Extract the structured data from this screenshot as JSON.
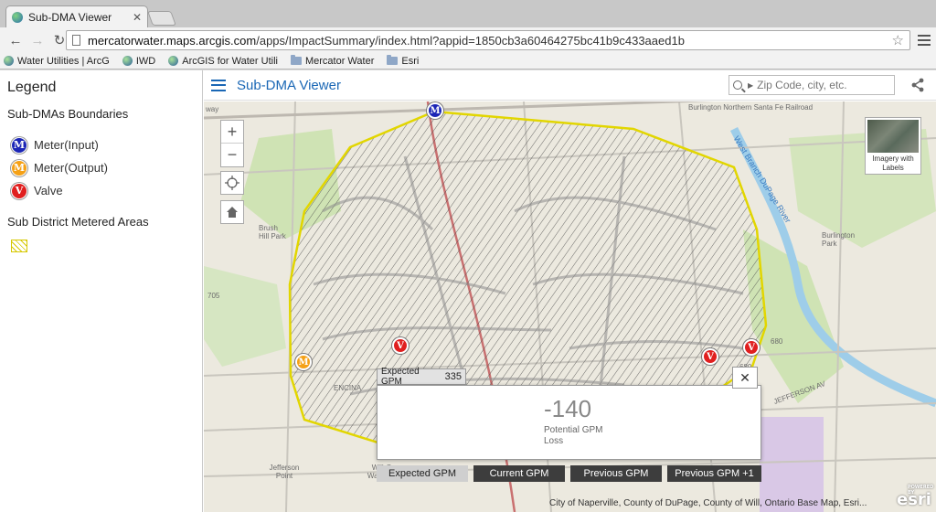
{
  "browser": {
    "tab_title": "Sub-DMA Viewer",
    "url_host": "mercatorwater.maps.arcgis.com",
    "url_path": "/apps/ImpactSummary/index.html?appid=1850cb3a60464275bc41b9c433aaed1b",
    "bookmarks": [
      {
        "label": "Water Utilities | ArcG",
        "icon": "globe-icon"
      },
      {
        "label": "IWD",
        "icon": "globe-icon"
      },
      {
        "label": "ArcGIS for Water Utili",
        "icon": "globe-icon"
      },
      {
        "label": "Mercator Water",
        "icon": "folder-icon"
      },
      {
        "label": "Esri",
        "icon": "folder-icon"
      }
    ]
  },
  "legend": {
    "title": "Legend",
    "section1": "Sub-DMAs Boundaries",
    "items": [
      {
        "label": "Meter(Input)",
        "glyph": "M",
        "color": "#1c26b6"
      },
      {
        "label": "Meter(Output)",
        "glyph": "M",
        "color": "#f5a117"
      },
      {
        "label": "Valve",
        "glyph": "V",
        "color": "#e01f1f"
      }
    ],
    "section2": "Sub District Metered Areas"
  },
  "header": {
    "title": "Sub-DMA Viewer",
    "search_placeholder": "Zip Code, city, etc."
  },
  "map": {
    "basemap_label": "Imagery with Labels",
    "labels": {
      "brush_hill": "Brush Hill Park",
      "burlington_park": "Burlington Park",
      "river": "West Branch DuPage River",
      "railway": "Burlington Northern Santa Fe Railroad",
      "way": "way",
      "jefferson": "Jefferson Point",
      "willpark": "Will-O-Way Park",
      "jefferson_av": "JEFFERSON AV",
      "encina": "ENCINA",
      "road705": "705",
      "road680": "680",
      "road680b": "680"
    },
    "markers": {
      "meter_input": "M",
      "meter_output": "M",
      "valve": "V"
    },
    "attribution": "City of Naperville, County of DuPage, County of Will, Ontario Base Map, Esri...",
    "esri_powered": "POWERED BY",
    "esri_name": "esri"
  },
  "popup": {
    "tab_label": "Expected GPM",
    "tab_value": "335",
    "value": "-140",
    "caption_line1": "Potential GPM",
    "caption_line2": "Loss",
    "buttons": [
      "Expected GPM",
      "Current GPM",
      "Previous GPM",
      "Previous GPM +1"
    ],
    "selected_button": "Expected GPM"
  },
  "colors": {
    "accent": "#1a67b5",
    "boundary": "#d6c800",
    "meter_input": "#1c26b6",
    "meter_output": "#f5a117",
    "valve": "#e01f1f"
  }
}
